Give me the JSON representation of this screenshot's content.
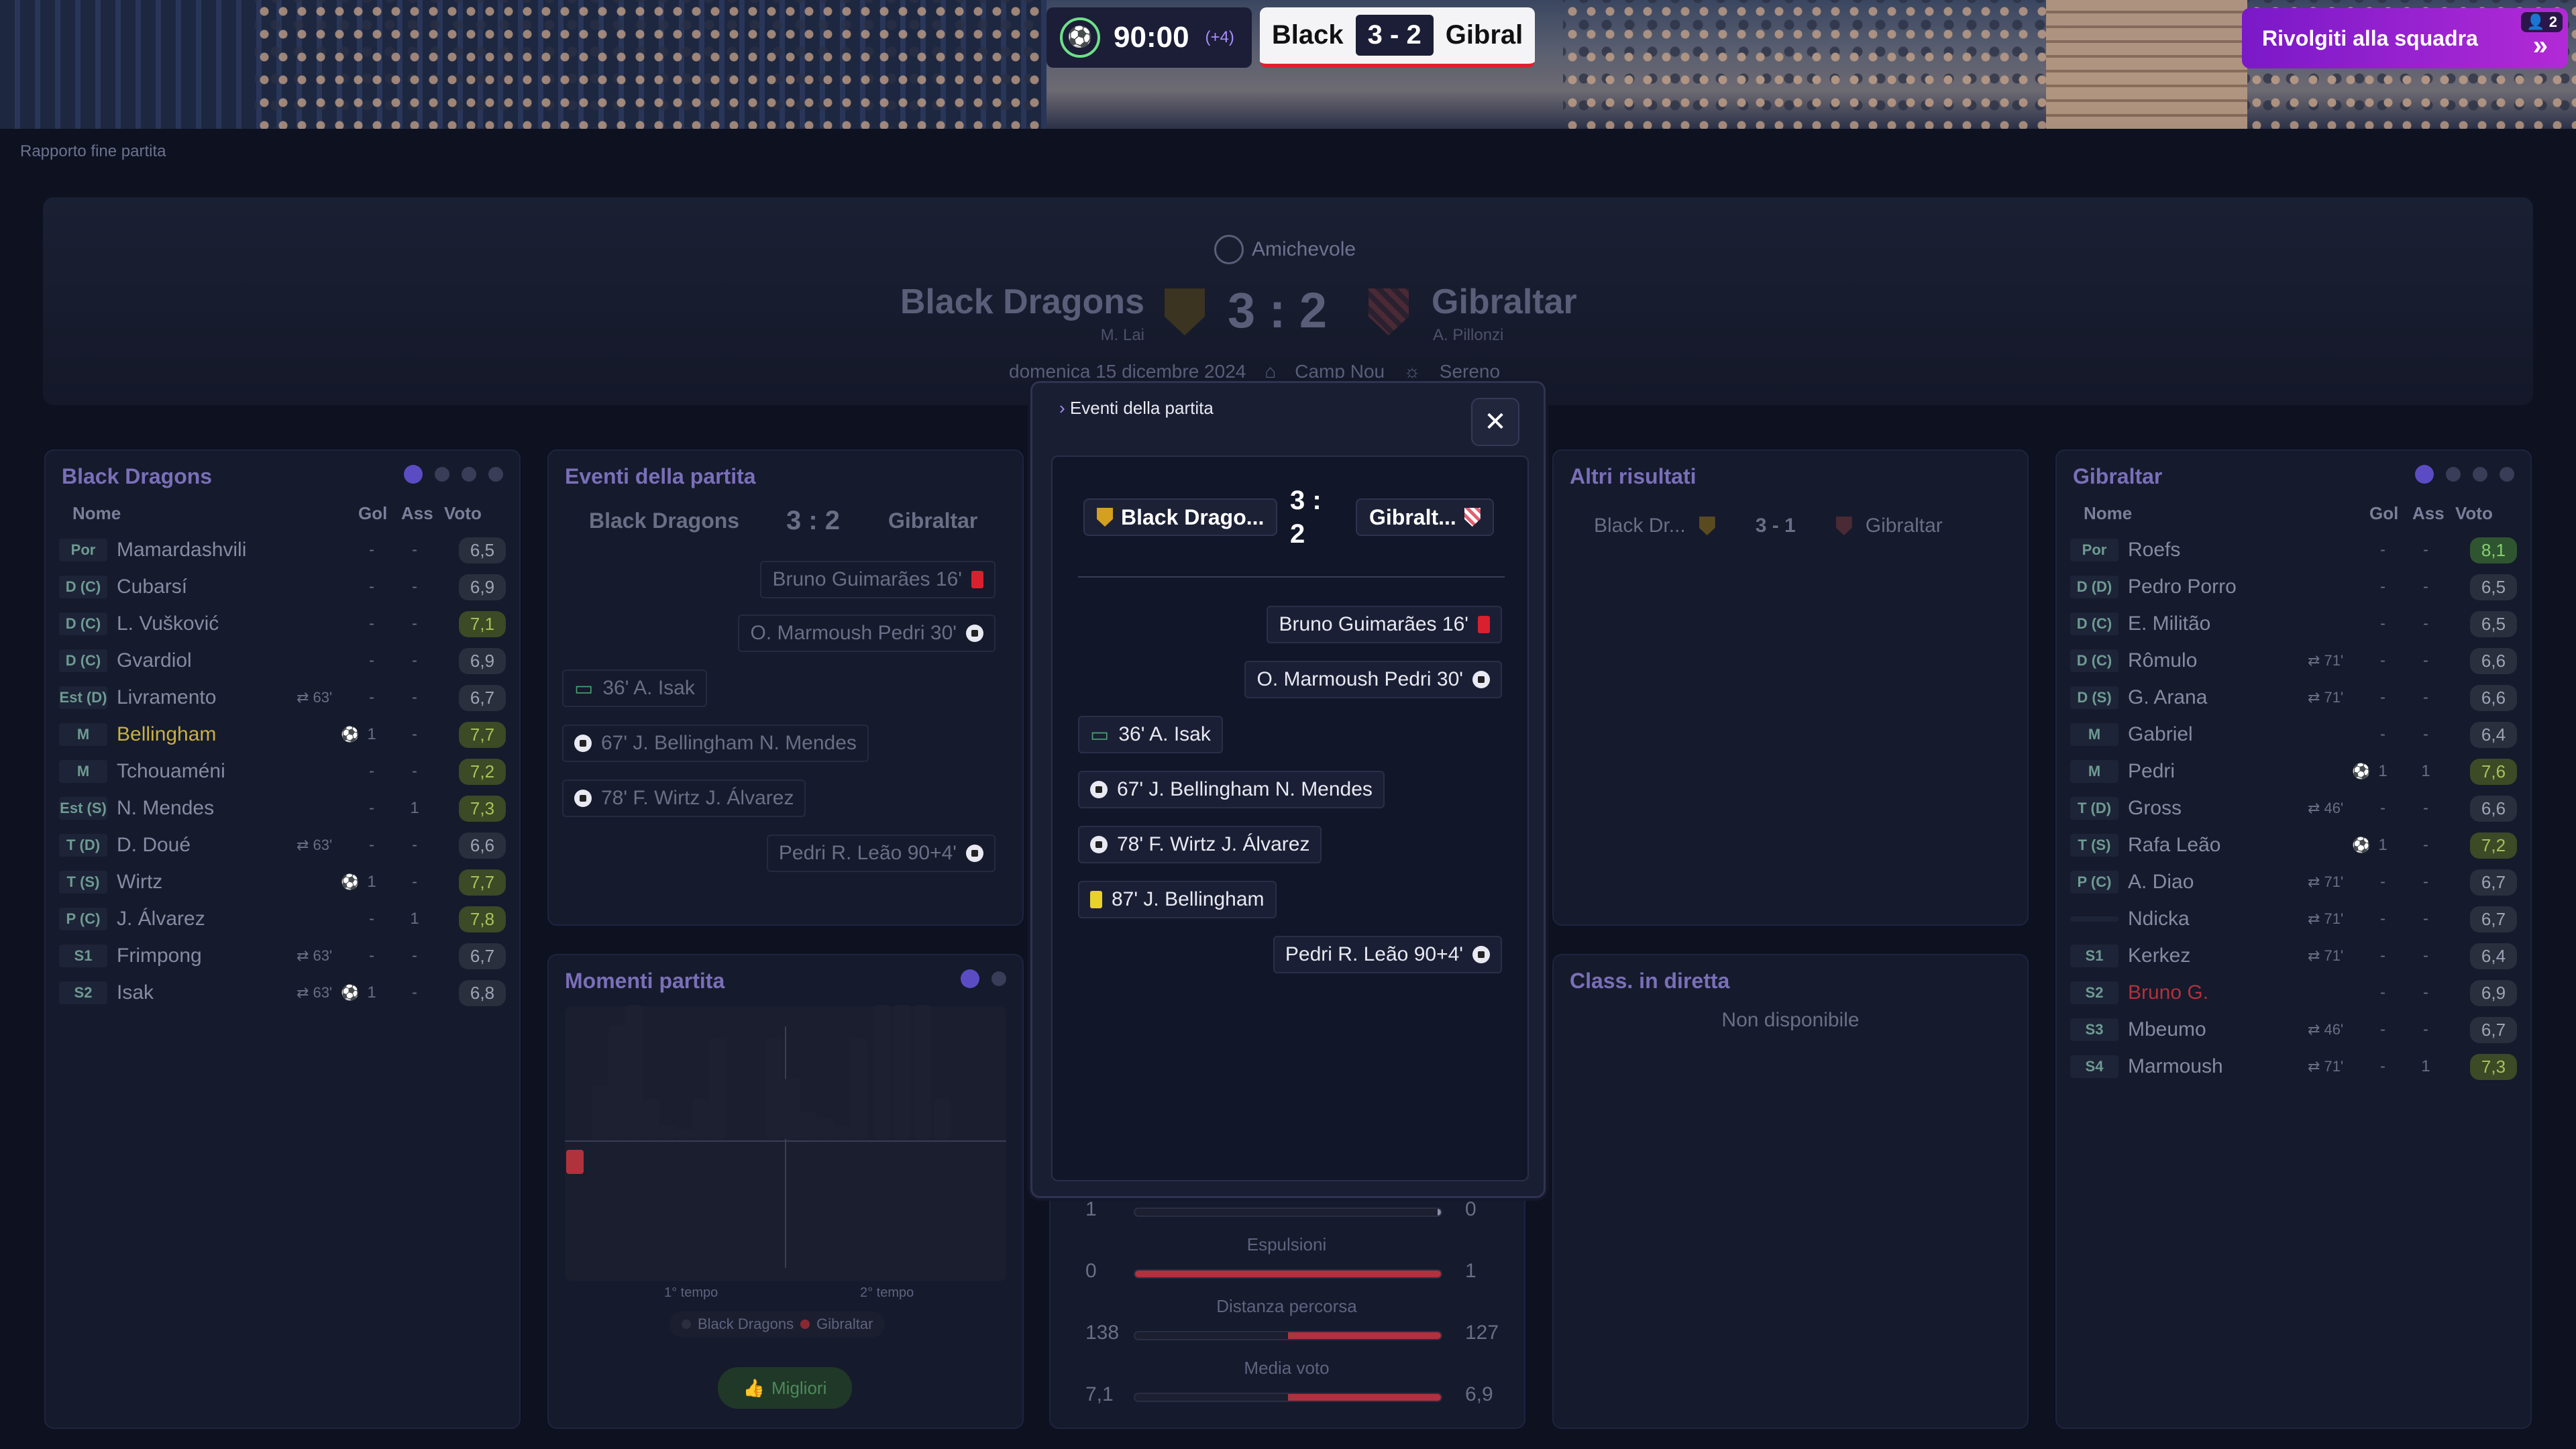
{
  "topbar": {
    "clock": "90:00",
    "added_time": "(+4)",
    "home_short": "Black",
    "score": "3 - 2",
    "away_short": "Gibral",
    "talk_button": "Rivolgiti alla squadra",
    "badge_count": "2"
  },
  "breadcrumb": "Rapporto fine partita",
  "match": {
    "type": "Amichevole",
    "home": "Black Dragons",
    "home_coach": "M. Lai",
    "away": "Gibraltar",
    "away_coach": "A. Pillonzi",
    "score": "3 : 2",
    "date": "domenica 15 dicembre 2024",
    "venue": "Camp Nou",
    "weather": "Sereno"
  },
  "home_panel": {
    "title": "Black Dragons",
    "cols": {
      "name": "Nome",
      "goals": "Gol",
      "assists": "Ass",
      "rating": "Voto"
    },
    "players": [
      {
        "pos": "Por",
        "name": "Mamardashvili",
        "sub": "",
        "gol": "-",
        "ass": "-",
        "voto": "6,5"
      },
      {
        "pos": "D (C)",
        "name": "Cubarsí",
        "sub": "",
        "gol": "-",
        "ass": "-",
        "voto": "6,9"
      },
      {
        "pos": "D (C)",
        "name": "L. Vušković",
        "sub": "",
        "gol": "-",
        "ass": "-",
        "voto": "7,1"
      },
      {
        "pos": "D (C)",
        "name": "Gvardiol",
        "sub": "",
        "gol": "-",
        "ass": "-",
        "voto": "6,9"
      },
      {
        "pos": "Est (D)",
        "name": "Livramento",
        "sub": "63'",
        "gol": "-",
        "ass": "-",
        "voto": "6,7"
      },
      {
        "pos": "M",
        "name": "Bellingham",
        "sub": "",
        "gol": "1",
        "ass": "-",
        "voto": "7,7"
      },
      {
        "pos": "M",
        "name": "Tchouaméni",
        "sub": "",
        "gol": "-",
        "ass": "-",
        "voto": "7,2"
      },
      {
        "pos": "Est (S)",
        "name": "N. Mendes",
        "sub": "",
        "gol": "-",
        "ass": "1",
        "voto": "7,3"
      },
      {
        "pos": "T (D)",
        "name": "D. Doué",
        "sub": "63'",
        "gol": "-",
        "ass": "-",
        "voto": "6,6"
      },
      {
        "pos": "T (S)",
        "name": "Wirtz",
        "sub": "",
        "gol": "1",
        "ass": "-",
        "voto": "7,7"
      },
      {
        "pos": "P (C)",
        "name": "J. Álvarez",
        "sub": "",
        "gol": "-",
        "ass": "1",
        "voto": "7,8"
      },
      {
        "pos": "S1",
        "name": "Frimpong",
        "sub": "63'",
        "gol": "-",
        "ass": "-",
        "voto": "6,7"
      },
      {
        "pos": "S2",
        "name": "Isak",
        "sub": "63'",
        "gol": "1",
        "ass": "-",
        "voto": "6,8"
      }
    ]
  },
  "away_panel": {
    "title": "Gibraltar",
    "cols": {
      "name": "Nome",
      "goals": "Gol",
      "assists": "Ass",
      "rating": "Voto"
    },
    "players": [
      {
        "pos": "Por",
        "name": "Roefs",
        "sub": "",
        "gol": "-",
        "ass": "-",
        "voto": "8,1"
      },
      {
        "pos": "D (D)",
        "name": "Pedro Porro",
        "sub": "",
        "gol": "-",
        "ass": "-",
        "voto": "6,5"
      },
      {
        "pos": "D (C)",
        "name": "E. Militão",
        "sub": "",
        "gol": "-",
        "ass": "-",
        "voto": "6,5"
      },
      {
        "pos": "D (C)",
        "name": "Rômulo",
        "sub": "71'",
        "gol": "-",
        "ass": "-",
        "voto": "6,6"
      },
      {
        "pos": "D (S)",
        "name": "G. Arana",
        "sub": "71'",
        "gol": "-",
        "ass": "-",
        "voto": "6,6"
      },
      {
        "pos": "M",
        "name": "Gabriel",
        "sub": "",
        "gol": "-",
        "ass": "-",
        "voto": "6,4"
      },
      {
        "pos": "M",
        "name": "Pedri",
        "sub": "",
        "gol": "1",
        "ass": "1",
        "voto": "7,6"
      },
      {
        "pos": "T (D)",
        "name": "Gross",
        "sub": "46'",
        "gol": "-",
        "ass": "-",
        "voto": "6,6"
      },
      {
        "pos": "T (S)",
        "name": "Rafa Leão",
        "sub": "",
        "gol": "1",
        "ass": "-",
        "voto": "7,2"
      },
      {
        "pos": "P (C)",
        "name": "A. Diao",
        "sub": "71'",
        "gol": "-",
        "ass": "-",
        "voto": "6,7"
      },
      {
        "pos": "",
        "name": "Ndicka",
        "sub": "71'",
        "gol": "-",
        "ass": "-",
        "voto": "6,7"
      },
      {
        "pos": "S1",
        "name": "Kerkez",
        "sub": "71'",
        "gol": "-",
        "ass": "-",
        "voto": "6,4"
      },
      {
        "pos": "S2",
        "name": "Bruno G.",
        "sub": "",
        "gol": "-",
        "ass": "-",
        "voto": "6,9"
      },
      {
        "pos": "S3",
        "name": "Mbeumo",
        "sub": "46'",
        "gol": "-",
        "ass": "-",
        "voto": "6,7"
      },
      {
        "pos": "S4",
        "name": "Marmoush",
        "sub": "71'",
        "gol": "-",
        "ass": "1",
        "voto": "7,3"
      }
    ]
  },
  "events_panel": {
    "title": "Eventi della partita",
    "home": "Black Dragons",
    "score": "3 : 2",
    "away": "Gibraltar",
    "events": [
      "Bruno Guimarães 16'",
      "O. Marmoush Pedri 30'",
      "36' A. Isak",
      "67' J. Bellingham N. Mendes",
      "78' F. Wirtz J. Álvarez",
      "Pedri R. Leão 90+4'"
    ]
  },
  "moments_panel": {
    "title": "Momenti partita",
    "first_half": "1° tempo",
    "second_half": "2° tempo",
    "legend_home": "Black Dragons",
    "legend_away": "Gibraltar",
    "best_button": "Migliori"
  },
  "other_results": {
    "title": "Altri risultati",
    "home": "Black Dr...",
    "score": "3 - 1",
    "away": "Gibraltar"
  },
  "live_table": {
    "title": "Class. in diretta",
    "message": "Non disponibile"
  },
  "modal": {
    "title": "Eventi della partita",
    "home": "Black Drago...",
    "score_top": "3 :",
    "score_bottom": "2",
    "away": "Gibralt...",
    "events": [
      {
        "text": "Bruno Guimarães 16'",
        "side": "away",
        "icon": "red-card"
      },
      {
        "text": "O. Marmoush Pedri 30'",
        "side": "away",
        "icon": "ball"
      },
      {
        "text": "36' A. Isak",
        "side": "home",
        "icon": "penalty"
      },
      {
        "text": "67' J. Bellingham N. Mendes",
        "side": "home",
        "icon": "ball"
      },
      {
        "text": "78' F. Wirtz J. Álvarez",
        "side": "home",
        "icon": "ball"
      },
      {
        "text": "87' J. Bellingham",
        "side": "home",
        "icon": "yellow-card"
      },
      {
        "text": "Pedri R. Leão 90+4'",
        "side": "away",
        "icon": "ball"
      }
    ]
  },
  "stats": [
    {
      "label": "",
      "home": "1",
      "away": "0",
      "home_frac": 0.0,
      "away_frac": 0.0
    },
    {
      "label": "Espulsioni",
      "home": "0",
      "away": "1",
      "home_frac": 0.0,
      "away_frac": 1.0
    },
    {
      "label": "Distanza percorsa",
      "home": "138",
      "away": "127",
      "home_frac": 0.0,
      "away_frac": 0.5
    },
    {
      "label": "Media voto",
      "home": "7,1",
      "away": "6,9",
      "home_frac": 0.0,
      "away_frac": 0.5
    }
  ],
  "colors": {
    "accent": "#7a19c8",
    "red": "#d8202e",
    "yellow": "#e8d12a",
    "panel": "#151a2c"
  }
}
